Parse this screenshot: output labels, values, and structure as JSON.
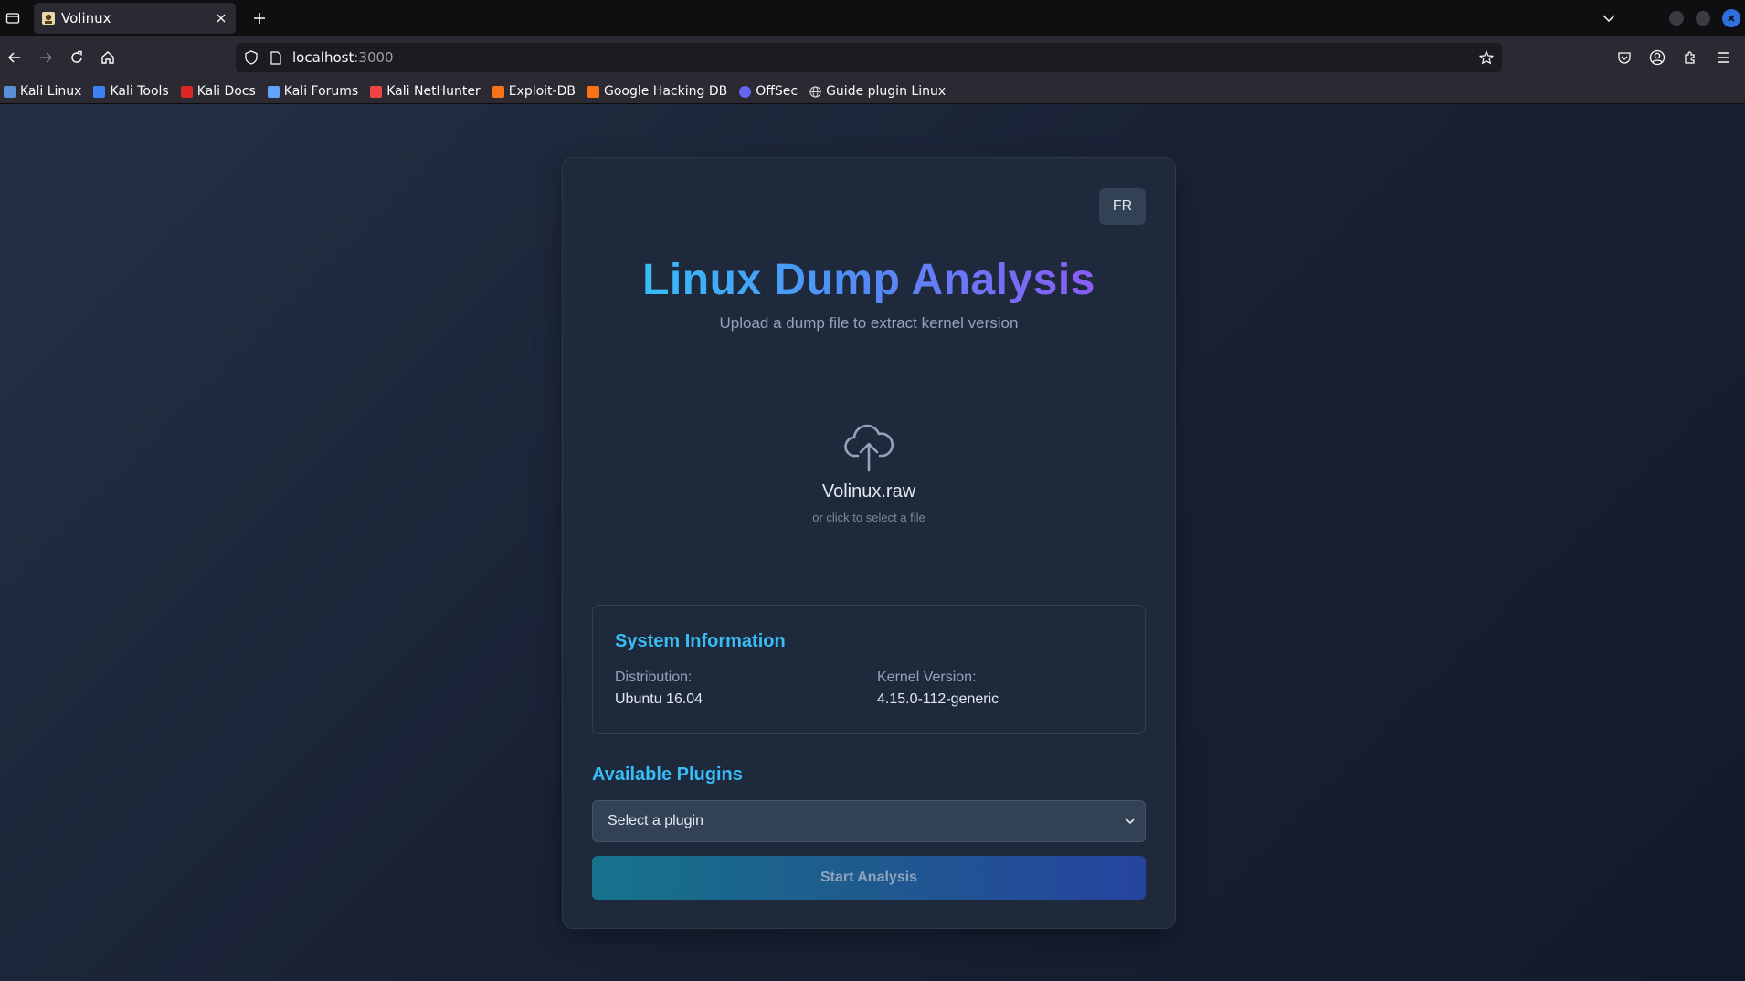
{
  "browser": {
    "tab_title": "Volinux",
    "url_host": "localhost",
    "url_port": ":3000",
    "bookmarks": [
      {
        "label": "Kali Linux",
        "color": "#5a8fd6"
      },
      {
        "label": "Kali Tools",
        "color": "#3b82f6"
      },
      {
        "label": "Kali Docs",
        "color": "#dc2626"
      },
      {
        "label": "Kali Forums",
        "color": "#60a5fa"
      },
      {
        "label": "Kali NetHunter",
        "color": "#ef4444"
      },
      {
        "label": "Exploit-DB",
        "color": "#f97316"
      },
      {
        "label": "Google Hacking DB",
        "color": "#f97316"
      },
      {
        "label": "OffSec",
        "color": "#6366f1"
      },
      {
        "label": "Guide plugin Linux",
        "color": "#d4d4d8"
      }
    ]
  },
  "app": {
    "lang_toggle": "FR",
    "title": "Linux Dump Analysis",
    "subtitle": "Upload a dump file to extract kernel version",
    "upload": {
      "filename": "Volinux.raw",
      "hint": "or click to select a file"
    },
    "system_info": {
      "heading": "System Information",
      "distribution_label": "Distribution:",
      "distribution_value": "Ubuntu 16.04",
      "kernel_label": "Kernel Version:",
      "kernel_value": "4.15.0-112-generic"
    },
    "plugins": {
      "heading": "Available Plugins",
      "select_placeholder": "Select a plugin"
    },
    "start_button": "Start Analysis"
  },
  "colors": {
    "accent": "#38bdf8",
    "card_bg": "#1e293b",
    "title_gradient": [
      "#38bdf8",
      "#4f8ef7",
      "#8b5cf6"
    ]
  }
}
